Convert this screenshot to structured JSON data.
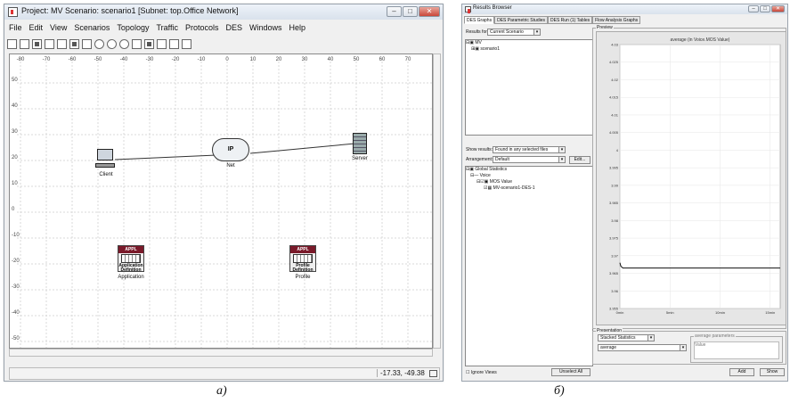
{
  "window_a": {
    "title": "Project: MV Scenario: scenario1  [Subnet: top.Office Network]",
    "menu": [
      "File",
      "Edit",
      "View",
      "Scenarios",
      "Topology",
      "Traffic",
      "Protocols",
      "DES",
      "Windows",
      "Help"
    ],
    "ruler_x": [
      "-80",
      "-70",
      "-60",
      "-50",
      "-40",
      "-30",
      "-20",
      "-10",
      "0",
      "10",
      "20",
      "30",
      "40",
      "50",
      "60",
      "70"
    ],
    "ruler_y": [
      "50",
      "40",
      "30",
      "20",
      "10",
      "0",
      "-10",
      "-20",
      "-30",
      "-40",
      "-50"
    ],
    "nodes": {
      "client": "Client",
      "net_cloud": "IP",
      "net": "Net",
      "server": "Server",
      "app_badge": "APPL",
      "app_caption": "Application\nDefinition",
      "app_label": "Application",
      "profile_badge": "APPL",
      "profile_caption": "Profile\nDefinition",
      "profile_label": "Profile"
    },
    "coords": "-17.33, -49.38"
  },
  "window_b": {
    "title": "Results Browser",
    "tabs": [
      "DES Graphs",
      "DES Parametric Studies",
      "DES Run (1) Tables",
      "Flow Analysis Graphs"
    ],
    "results_for_label": "Results for:",
    "results_for_value": "Current Scenario",
    "tree_top": [
      "MV",
      "scenario1"
    ],
    "show_results_label": "Show results:",
    "show_results_value": "Found in any selected files",
    "arrangement_label": "Arrangement:",
    "arrangement_value": "Default",
    "edit_button": "Edit...",
    "tree_bottom": [
      "Global Statistics",
      "Voice",
      "MOS Value",
      "MV-scenario1-DES-1"
    ],
    "ignore_views": "Ignore Views",
    "unselect_all": "Unselect All",
    "preview_label": "Preview",
    "presentation_label": "Presentation",
    "presentation_value": "Stacked Statistics",
    "presentation_sub": "average",
    "avg_params_label": "average parameters",
    "value_header": "Value",
    "add_button": "Add",
    "show_button": "Show"
  },
  "chart_data": {
    "type": "line",
    "title": "average (in Voice.MOS Value)",
    "x_ticks": [
      "0min",
      "5min",
      "10min",
      "15min"
    ],
    "y_ticks": [
      "4.03",
      "4.025",
      "4.02",
      "4.015",
      "4.01",
      "4.005",
      "4",
      "3.995",
      "3.99",
      "3.985",
      "3.98",
      "3.975",
      "3.97",
      "3.965",
      "3.96",
      "3.955"
    ],
    "ylim": [
      3.955,
      4.03
    ],
    "xlim": [
      0,
      16
    ],
    "series": [
      {
        "x": [
          0,
          0.1,
          0.3,
          1,
          5,
          10,
          15,
          16
        ],
        "values": [
          3.968,
          3.967,
          3.9665,
          3.9665,
          3.9665,
          3.9665,
          3.9665,
          3.9665
        ]
      }
    ]
  },
  "figure_labels": {
    "a": "а)",
    "b": "б)"
  }
}
